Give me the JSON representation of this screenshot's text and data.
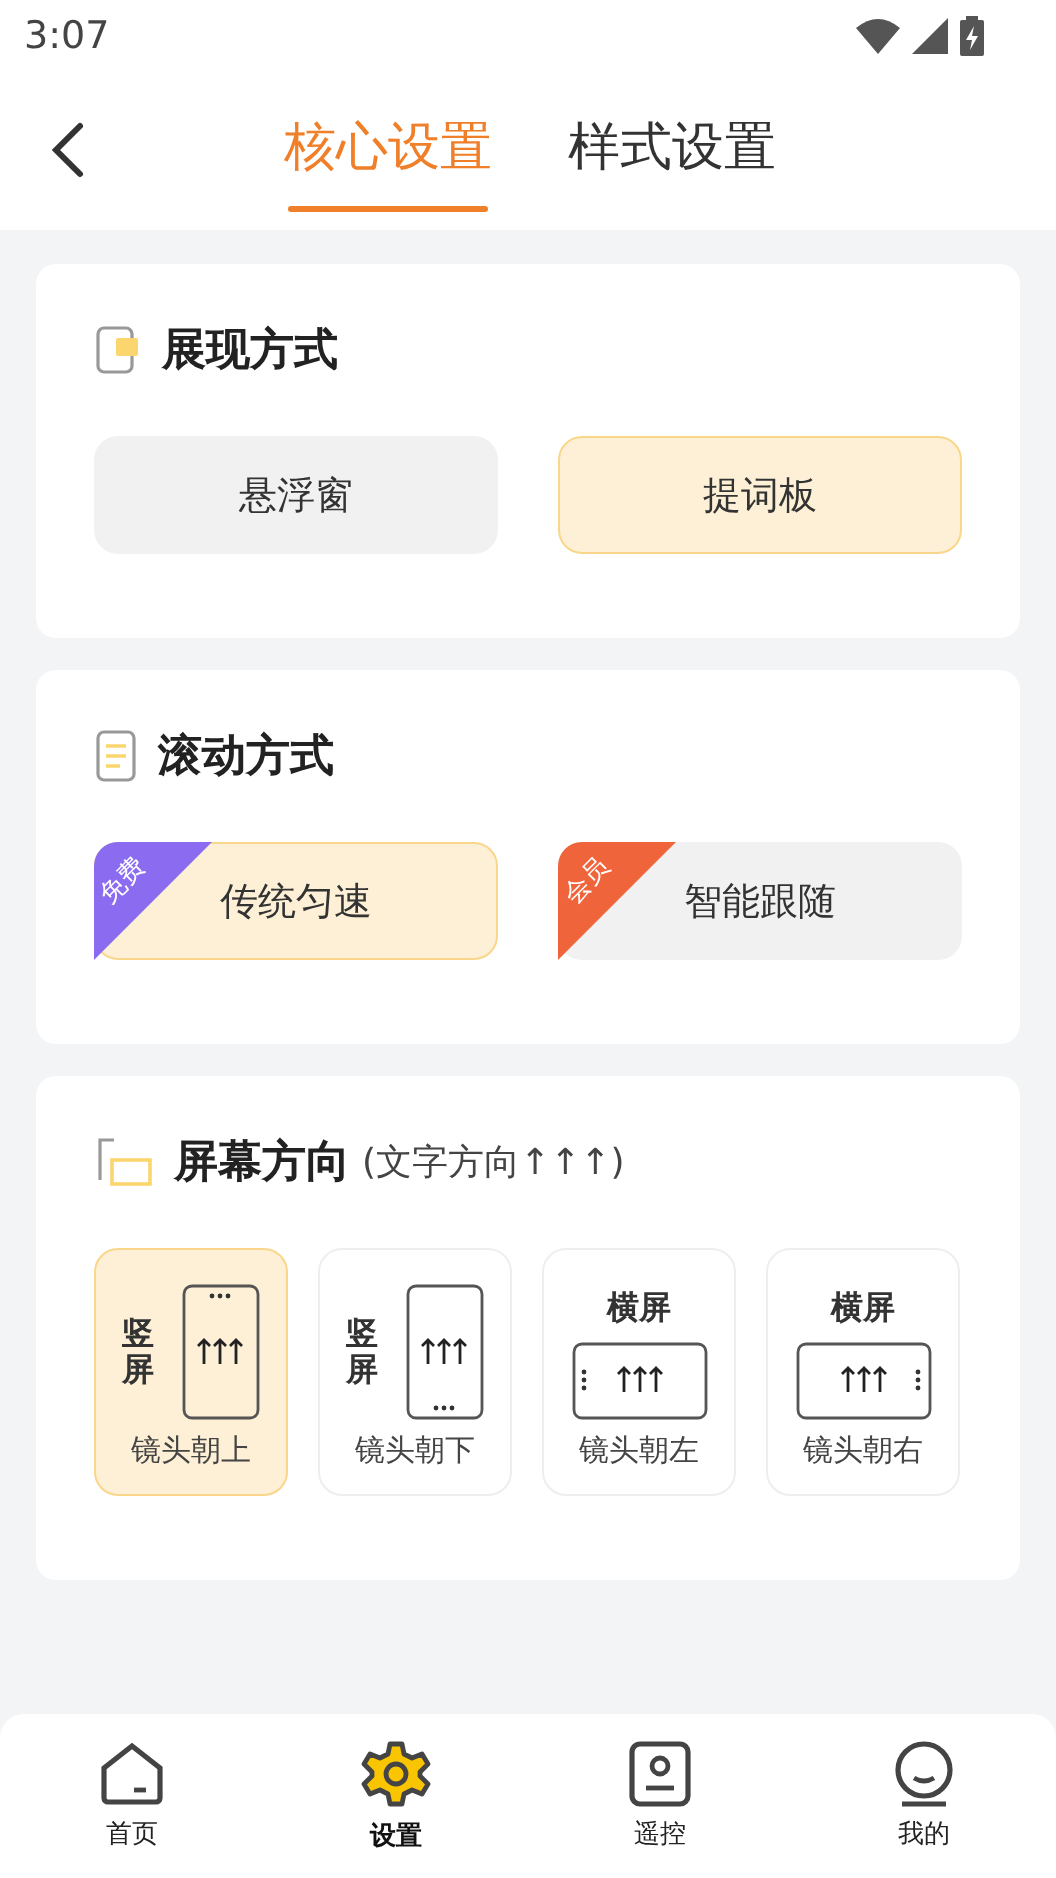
{
  "status_bar": {
    "time": "3:07"
  },
  "tabs": [
    {
      "label": "核心设置",
      "selected": true
    },
    {
      "label": "样式设置",
      "selected": false
    }
  ],
  "display_mode": {
    "title": "展现方式",
    "options": [
      {
        "label": "悬浮窗",
        "selected": false
      },
      {
        "label": "提词板",
        "selected": true
      }
    ]
  },
  "scroll_mode": {
    "title": "滚动方式",
    "options": [
      {
        "label": "传统匀速",
        "selected": true,
        "badge": "免费",
        "color": "#8b6cf0"
      },
      {
        "label": "智能跟随",
        "selected": false,
        "badge": "会员",
        "color": "#f0643c"
      }
    ]
  },
  "orientation": {
    "title": "屏幕方向",
    "note": "(文字方向↑↑↑)",
    "options": [
      {
        "kind": "up",
        "heading": "竖屏",
        "label": "镜头朝上",
        "selected": true
      },
      {
        "kind": "down",
        "heading": "竖屏",
        "label": "镜头朝下",
        "selected": false
      },
      {
        "kind": "left",
        "heading": "横屏",
        "label": "镜头朝左",
        "selected": false
      },
      {
        "kind": "right",
        "heading": "横屏",
        "label": "镜头朝右",
        "selected": false
      }
    ]
  },
  "bottom_nav": [
    {
      "label": "首页",
      "selected": false
    },
    {
      "label": "设置",
      "selected": true
    },
    {
      "label": "遥控",
      "selected": false
    },
    {
      "label": "我的",
      "selected": false
    }
  ]
}
